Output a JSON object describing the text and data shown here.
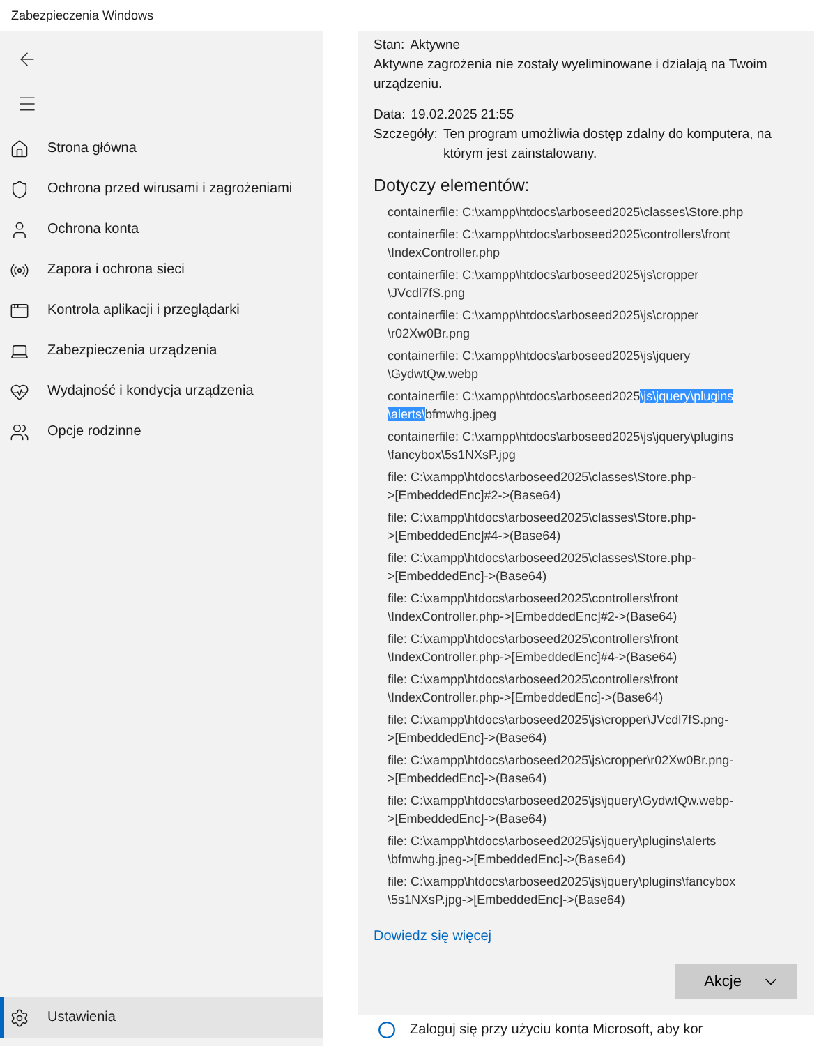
{
  "window": {
    "title": "Zabezpieczenia Windows"
  },
  "sidebar": {
    "items": [
      {
        "label": "Strona główna",
        "selected": false
      },
      {
        "label": "Ochrona przed wirusami i zagrożeniami",
        "selected": false
      },
      {
        "label": "Ochrona konta",
        "selected": false
      },
      {
        "label": "Zapora i ochrona sieci",
        "selected": false
      },
      {
        "label": "Kontrola aplikacji i przeglądarki",
        "selected": false
      },
      {
        "label": "Zabezpieczenia urządzenia",
        "selected": false
      },
      {
        "label": "Wydajność i kondycja urządzenia",
        "selected": false
      },
      {
        "label": "Opcje rodzinne",
        "selected": false
      }
    ],
    "settings": {
      "label": "Ustawienia",
      "selected": true
    }
  },
  "threat": {
    "status_label": "Stan:",
    "status": "Aktywne",
    "description": "Aktywne zagrożenia nie zostały wyeliminowane i działają na Twoim urządzeniu.",
    "date_label": "Data:",
    "date": "19.02.2025 21:55",
    "details_label": "Szczegóły:",
    "details": "Ten program umożliwia dostęp zdalny do komputera, na którym jest zainstalowany.",
    "affected_heading": "Dotyczy elementów:",
    "affected": [
      {
        "text": "containerfile: C:\\xampp\\htdocs\\arboseed2025\\classes\\Store.php"
      },
      {
        "text": "containerfile: C:\\xampp\\htdocs\\arboseed2025\\controllers\\front\n\\IndexController.php"
      },
      {
        "text": "containerfile: C:\\xampp\\htdocs\\arboseed2025\\js\\cropper\n\\JVcdl7fS.png"
      },
      {
        "text": "containerfile: C:\\xampp\\htdocs\\arboseed2025\\js\\cropper\n\\r02Xw0Br.png"
      },
      {
        "text": "containerfile: C:\\xampp\\htdocs\\arboseed2025\\js\\jquery\n\\GydwtQw.webp"
      },
      {
        "parts": [
          {
            "text": "containerfile: C:\\xampp\\htdocs\\arboseed2025",
            "selected": false
          },
          {
            "text": "\\js\\jquery\\plugins\n\\alerts\\",
            "selected": true
          },
          {
            "text": "bfmwhg.jpeg",
            "selected": false
          }
        ]
      },
      {
        "text": "containerfile: C:\\xampp\\htdocs\\arboseed2025\\js\\jquery\\plugins\n\\fancybox\\5s1NXsP.jpg"
      },
      {
        "text": "file: C:\\xampp\\htdocs\\arboseed2025\\classes\\Store.php-\n>[EmbeddedEnc]#2->(Base64)"
      },
      {
        "text": "file: C:\\xampp\\htdocs\\arboseed2025\\classes\\Store.php-\n>[EmbeddedEnc]#4->(Base64)"
      },
      {
        "text": "file: C:\\xampp\\htdocs\\arboseed2025\\classes\\Store.php-\n>[EmbeddedEnc]->(Base64)"
      },
      {
        "text": "file: C:\\xampp\\htdocs\\arboseed2025\\controllers\\front\n\\IndexController.php->[EmbeddedEnc]#2->(Base64)"
      },
      {
        "text": "file: C:\\xampp\\htdocs\\arboseed2025\\controllers\\front\n\\IndexController.php->[EmbeddedEnc]#4->(Base64)"
      },
      {
        "text": "file: C:\\xampp\\htdocs\\arboseed2025\\controllers\\front\n\\IndexController.php->[EmbeddedEnc]->(Base64)"
      },
      {
        "text": "file: C:\\xampp\\htdocs\\arboseed2025\\js\\cropper\\JVcdl7fS.png-\n>[EmbeddedEnc]->(Base64)"
      },
      {
        "text": "file: C:\\xampp\\htdocs\\arboseed2025\\js\\cropper\\r02Xw0Br.png-\n>[EmbeddedEnc]->(Base64)"
      },
      {
        "text": "file: C:\\xampp\\htdocs\\arboseed2025\\js\\jquery\\GydwtQw.webp-\n>[EmbeddedEnc]->(Base64)"
      },
      {
        "text": "file: C:\\xampp\\htdocs\\arboseed2025\\js\\jquery\\plugins\\alerts\n\\bfmwhg.jpeg->[EmbeddedEnc]->(Base64)"
      },
      {
        "text": "file: C:\\xampp\\htdocs\\arboseed2025\\js\\jquery\\plugins\\fancybox\n\\5s1NXsP.jpg->[EmbeddedEnc]->(Base64)"
      }
    ],
    "learn_more": "Dowiedz się więcej",
    "actions_button": "Akcje"
  },
  "signin_notice": "Zaloguj się przy użyciu konta Microsoft, aby kor"
}
